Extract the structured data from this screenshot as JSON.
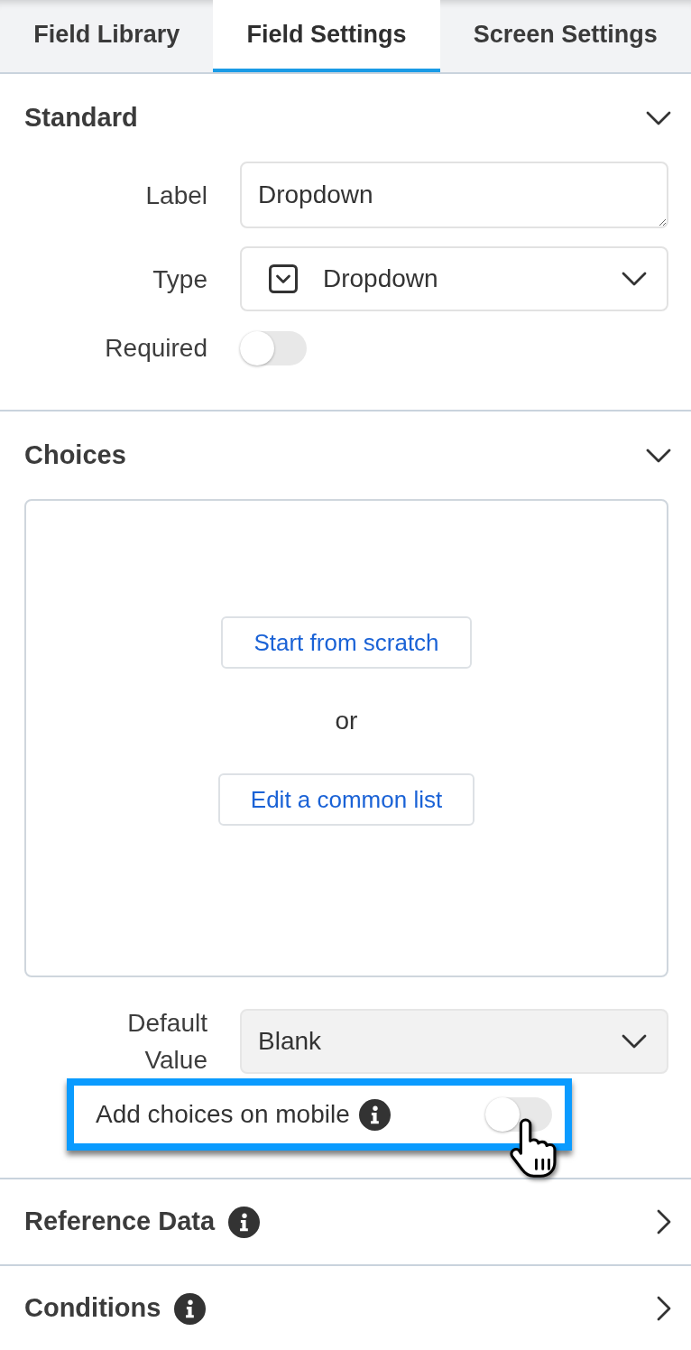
{
  "tabs": [
    {
      "label": "Field Library",
      "selected": false
    },
    {
      "label": "Field Settings",
      "selected": true
    },
    {
      "label": "Screen Settings",
      "selected": false
    }
  ],
  "sections": [
    {
      "title": "Standard",
      "expanded": true,
      "fields": [
        {
          "kind": "text",
          "label": "Label",
          "value": "Dropdown"
        },
        {
          "kind": "type_select",
          "label": "Type",
          "value": "Dropdown",
          "disabled": false
        },
        {
          "kind": "toggle",
          "label": "Required",
          "on": false
        }
      ]
    },
    {
      "title": "Choices",
      "expanded": true,
      "panel": {
        "buttons": [
          "Start from scratch",
          "Edit a common list"
        ],
        "separator": "or"
      },
      "fields": [
        {
          "kind": "select",
          "label": "Default Value",
          "value": "Blank",
          "disabled": true
        },
        {
          "kind": "inline_toggle",
          "label": "Add choices on mobile",
          "info": true,
          "on": false,
          "highlighted": true
        }
      ]
    },
    {
      "title": "Reference Data",
      "expanded": false,
      "info": true
    },
    {
      "title": "Conditions",
      "expanded": false,
      "info": true
    }
  ]
}
